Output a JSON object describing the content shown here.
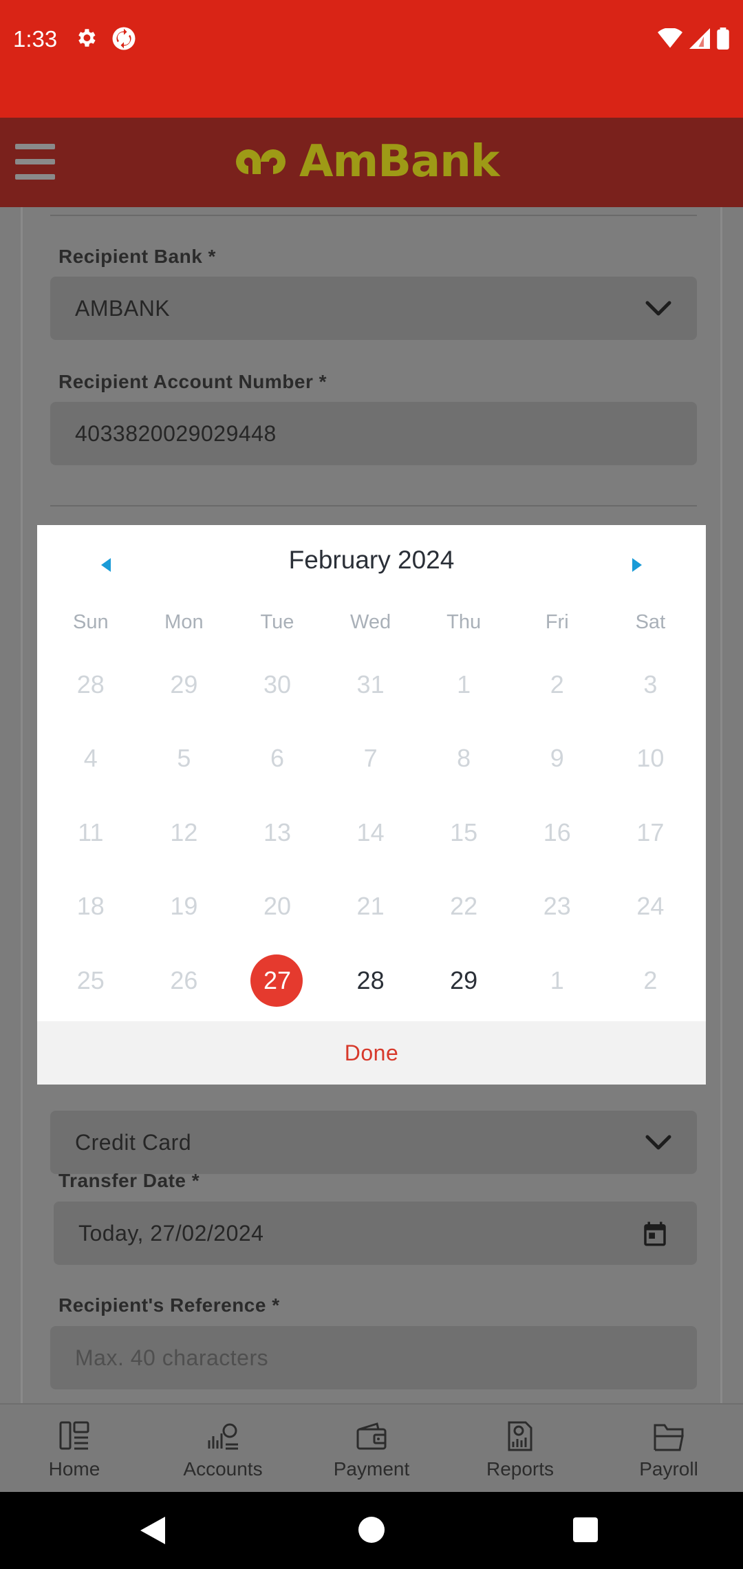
{
  "status_bar": {
    "time": "1:33"
  },
  "app_bar": {
    "brand": "AmBank"
  },
  "form": {
    "recipient_bank": {
      "label": "Recipient Bank *",
      "value": "AMBANK"
    },
    "recipient_account": {
      "label": "Recipient Account Number *",
      "value": "4033820029029448"
    },
    "payment_type": {
      "value": "Credit Card"
    },
    "transfer_date": {
      "label": "Transfer Date *",
      "value": "Today, 27/02/2024"
    },
    "recipient_reference": {
      "label": "Recipient's Reference *",
      "placeholder": "Max. 40 characters"
    }
  },
  "datepicker": {
    "title": "February 2024",
    "weekdays": [
      "Sun",
      "Mon",
      "Tue",
      "Wed",
      "Thu",
      "Fri",
      "Sat"
    ],
    "weeks": [
      [
        "28",
        "29",
        "30",
        "31",
        "1",
        "2",
        "3"
      ],
      [
        "4",
        "5",
        "6",
        "7",
        "8",
        "9",
        "10"
      ],
      [
        "11",
        "12",
        "13",
        "14",
        "15",
        "16",
        "17"
      ],
      [
        "18",
        "19",
        "20",
        "21",
        "22",
        "23",
        "24"
      ],
      [
        "25",
        "26",
        "27",
        "28",
        "29",
        "1",
        "2"
      ]
    ],
    "selected_day": "27",
    "enabled_days": [
      "27",
      "28",
      "29"
    ],
    "done_label": "Done",
    "selected_color": "#e53a2e"
  },
  "bottom_nav": [
    {
      "label": "Home",
      "icon": "home-icon"
    },
    {
      "label": "Accounts",
      "icon": "accounts-icon"
    },
    {
      "label": "Payment",
      "icon": "wallet-icon"
    },
    {
      "label": "Reports",
      "icon": "reports-icon"
    },
    {
      "label": "Payroll",
      "icon": "payroll-icon"
    }
  ],
  "colors": {
    "status_bar": "#d92416",
    "app_bar": "#7a211c",
    "brand": "#9e9a16",
    "accent": "#d7392b"
  }
}
